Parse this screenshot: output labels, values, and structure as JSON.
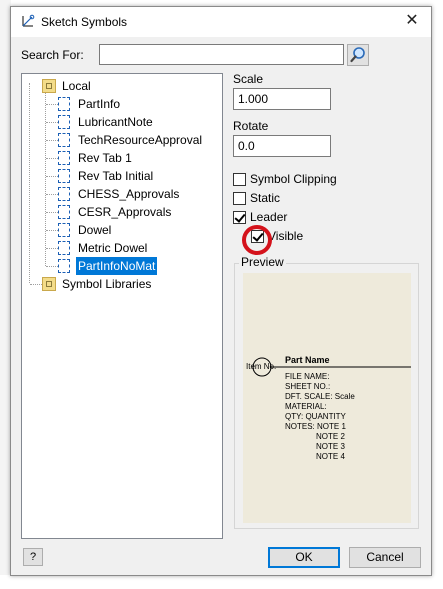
{
  "dialog": {
    "title": "Sketch Symbols",
    "close_glyph": "✕"
  },
  "search": {
    "label": "Search For:",
    "value": "",
    "button_icon": "search-icon"
  },
  "tree": {
    "root": "Local",
    "items": [
      "PartInfo",
      "LubricantNote",
      "TechResourceApproval",
      "Rev Tab 1",
      "Rev Tab Initial",
      "CHESS_Approvals",
      "CESR_Approvals",
      "Dowel",
      "Metric Dowel",
      "PartInfoNoMat"
    ],
    "selected": "PartInfoNoMat",
    "libraries": "Symbol Libraries"
  },
  "scale": {
    "label": "Scale",
    "value": "1.000"
  },
  "rotate": {
    "label": "Rotate",
    "value": "0.0"
  },
  "options": {
    "symbol_clipping": {
      "label": "Symbol Clipping",
      "checked": false
    },
    "static": {
      "label": "Static",
      "checked": false
    },
    "leader": {
      "label": "Leader",
      "checked": true
    },
    "visible": {
      "label": "Visible",
      "checked": true
    }
  },
  "preview": {
    "label": "Preview",
    "item_no": "Item No.",
    "part_name": "Part Name",
    "lines": [
      "FILE NAME:",
      "SHEET NO.:",
      "DFT. SCALE: Scale",
      "MATERIAL:",
      "QTY: QUANTITY",
      "NOTES: NOTE 1"
    ],
    "notes": [
      "NOTE 2",
      "NOTE 3",
      "NOTE 4"
    ]
  },
  "buttons": {
    "help": "?",
    "ok": "OK",
    "cancel": "Cancel"
  },
  "colors": {
    "selection": "#0078d7",
    "highlight_circle": "#d4121b",
    "preview_bg": "#eeeadb"
  }
}
